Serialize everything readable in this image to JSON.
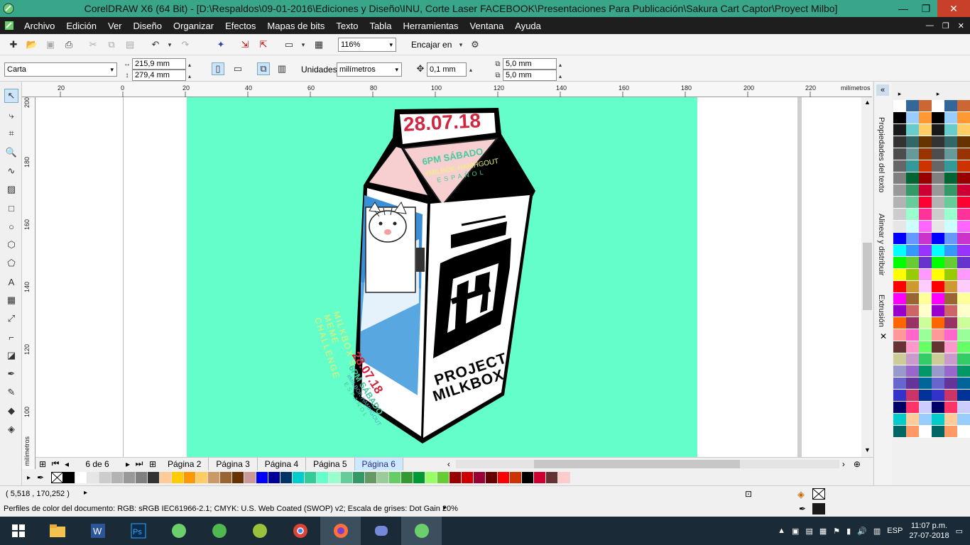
{
  "window": {
    "title": "CorelDRAW X6 (64 Bit) - [D:\\Respaldos\\09-01-2016\\Ediciones y Diseño\\INU, Corte Laser FACEBOOK\\Presentaciones Para Publicación\\Sakura Cart Captor\\Proyect Milbo]",
    "minimize": "—",
    "restore": "❐",
    "close": "✕"
  },
  "menu": [
    "Archivo",
    "Edición",
    "Ver",
    "Diseño",
    "Organizar",
    "Efectos",
    "Mapas de bits",
    "Texto",
    "Tabla",
    "Herramientas",
    "Ventana",
    "Ayuda"
  ],
  "toolbar": {
    "zoom": "116%",
    "snap_label": "Encajar en"
  },
  "properties": {
    "paper": "Carta",
    "width": "215,9 mm",
    "height": "279,4 mm",
    "units_label": "Unidades:",
    "units": "milímetros",
    "nudge": "0,1 mm",
    "dup_x": "5,0 mm",
    "dup_y": "5,0 mm"
  },
  "ruler": {
    "h_ticks": [
      "20",
      "0",
      "20",
      "40",
      "60",
      "80",
      "100",
      "120",
      "140",
      "160",
      "180",
      "200",
      "220"
    ],
    "unit": "milímetros",
    "v_ticks": [
      "200",
      "180",
      "160",
      "140",
      "120",
      "100"
    ],
    "v_unit": "milímetros"
  },
  "dockers": [
    "Propiedades del texto",
    "Alinear y distribuir",
    "Extrusión"
  ],
  "artwork": {
    "top_date": "28.07.18",
    "time": "6PM SÁBADO",
    "hashtag": "#MILBOK-HAMHGOUT",
    "lang": "ESPAÑOL",
    "challenge": "MILKBOX'S MEME CHALLENGE",
    "side_date": "28.07.18",
    "side_time": "6PM SÁBADO",
    "side_tag": "#MILBOK-HAMHGOUT",
    "side_lang": "ESPAÑOL",
    "brand1": "PROJECT",
    "brand2": "MILKBOX",
    "logo": "FP"
  },
  "pages": {
    "counter": "6 de 6",
    "tabs": [
      "Página 2",
      "Página 3",
      "Página 4",
      "Página 5",
      "Página 6"
    ],
    "active": "Página 6"
  },
  "status": {
    "coords": "( 5,518 , 170,252 )",
    "profile": "Perfiles de color del documento: RGB: sRGB IEC61966-2.1; CMYK: U.S. Web Coated (SWOP) v2; Escala de grises: Dot Gain 20%"
  },
  "taskbar": {
    "lang": "ESP",
    "time": "11:07 p.m.",
    "date": "27-07-2018"
  },
  "palette_right_1": [
    "#ffffff",
    "#000000",
    "#1a1a1a",
    "#333333",
    "#4d4d4d",
    "#666666",
    "#808080",
    "#999999",
    "#b3b3b3",
    "#cccccc",
    "#e6e6e6",
    "#0000ff",
    "#00ffff",
    "#00ff00",
    "#ffff00",
    "#ff0000",
    "#ff00ff",
    "#9900cc",
    "#ff6600",
    "#ff9999",
    "#663333",
    "#cccc99",
    "#9999cc",
    "#6666cc",
    "#3333cc",
    "#000066",
    "#00cccc",
    "#006666"
  ],
  "palette_right_2": [
    "#336699",
    "#99ccff",
    "#66cccc",
    "#336666",
    "#669999",
    "#339999",
    "#006633",
    "#339966",
    "#66cc99",
    "#99ffcc",
    "#ccffff",
    "#6699ff",
    "#3399ff",
    "#66cc33",
    "#99cc00",
    "#cc9933",
    "#996633",
    "#cc6666",
    "#993366",
    "#ff66cc",
    "#ff99cc",
    "#cc99cc",
    "#9966cc",
    "#663399",
    "#cc3366",
    "#ff3366",
    "#ffcc99",
    "#ff9966"
  ],
  "palette_right_3": [
    "#cc6633",
    "#ff9933",
    "#ffcc66",
    "#663300",
    "#993300",
    "#cc3300",
    "#990000",
    "#cc0033",
    "#ff0033",
    "#ff3399",
    "#ff66ff",
    "#cc33cc",
    "#9933ff",
    "#6633cc",
    "#ff99ff",
    "#ffccff",
    "#ffff99",
    "#ffffcc",
    "#ccff99",
    "#99ff99",
    "#66ff66",
    "#33cc66",
    "#009966",
    "#006699",
    "#003399",
    "#ccccff",
    "#99ccff",
    "#ffffff"
  ],
  "palette_bottom": [
    "#000000",
    "#ffffff",
    "#e6e6e6",
    "#cccccc",
    "#b3b3b3",
    "#999999",
    "#808080",
    "#333333",
    "#ffcc99",
    "#ffcc00",
    "#ff9900",
    "#ffcc66",
    "#cc9966",
    "#996633",
    "#663300",
    "#cc9999",
    "#0000ff",
    "#000099",
    "#003366",
    "#00cccc",
    "#33cc99",
    "#66ffcc",
    "#99ffcc",
    "#66cc99",
    "#339966",
    "#669966",
    "#99cc99",
    "#66cc66",
    "#339933",
    "#009933",
    "#99ff66",
    "#66cc33",
    "#990000",
    "#cc0000",
    "#990033",
    "#660000",
    "#ff0000",
    "#cc3300",
    "#000000",
    "#cc0033",
    "#663333",
    "#ffcccc"
  ]
}
